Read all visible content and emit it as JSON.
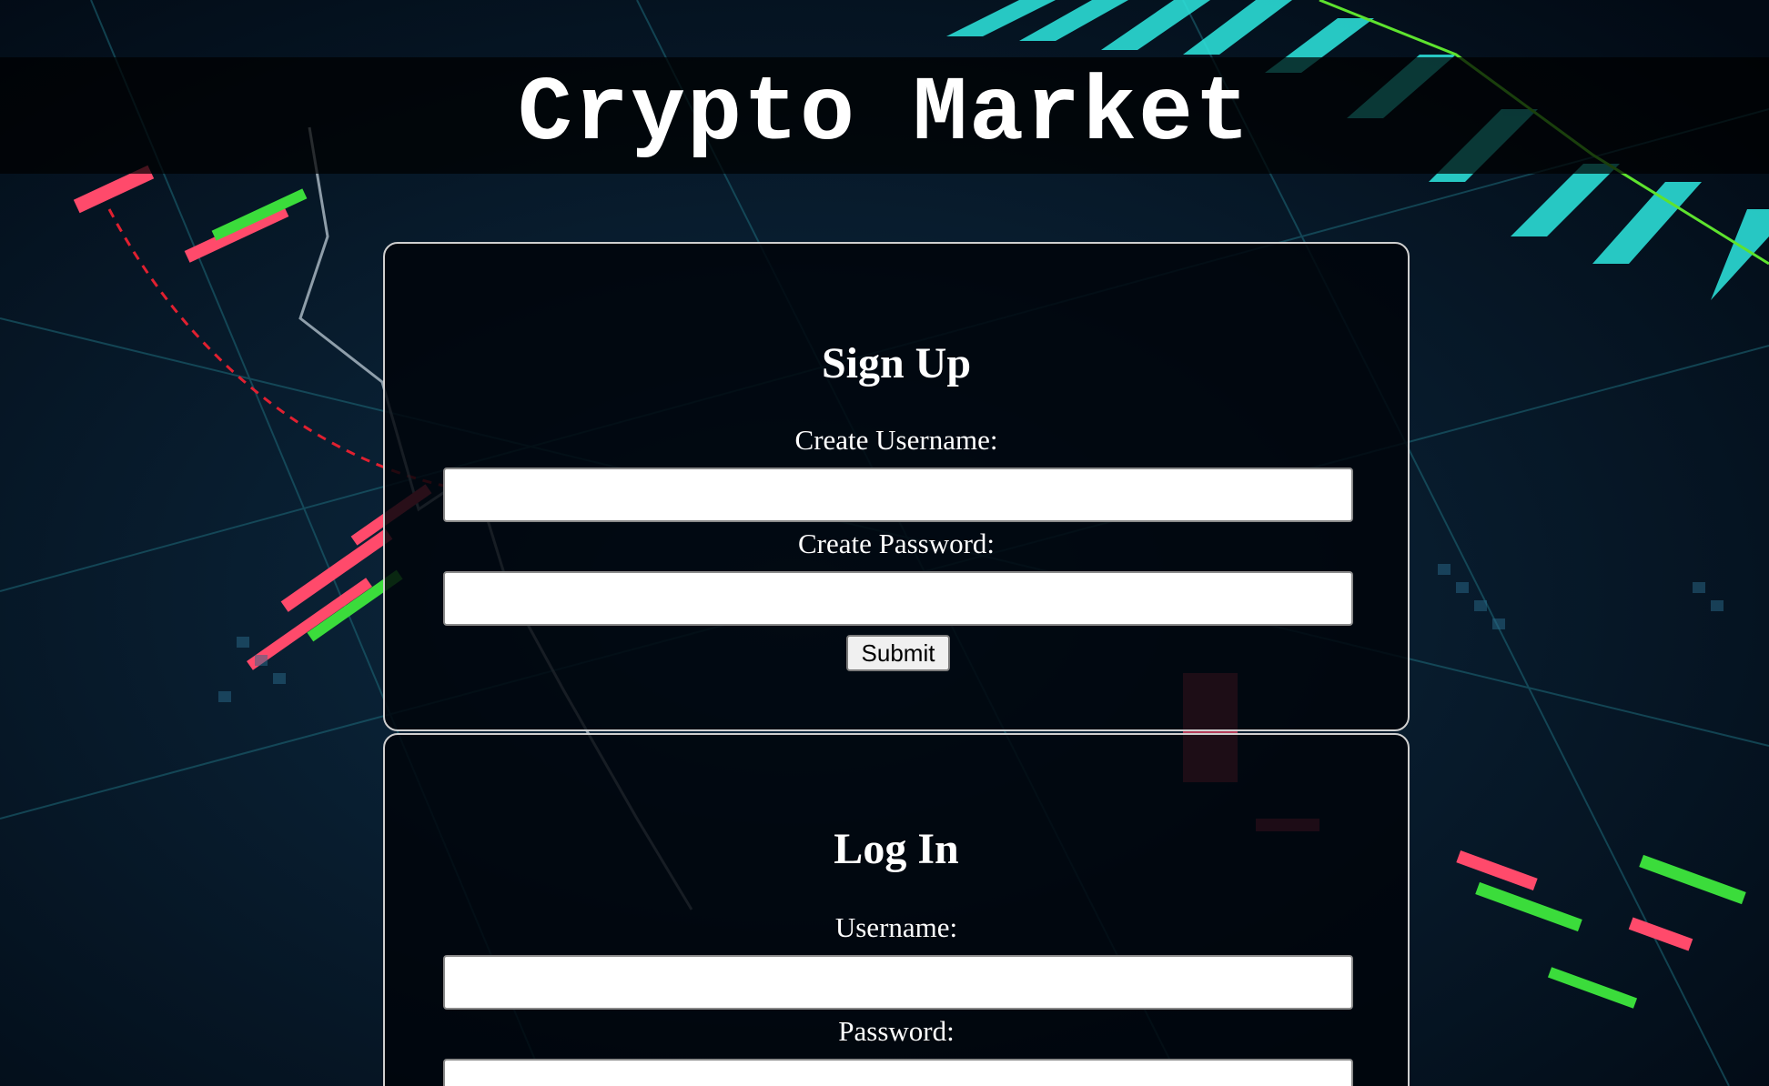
{
  "header": {
    "title": "Crypto Market"
  },
  "signup": {
    "heading": "Sign Up",
    "username_label": "Create Username:",
    "username_value": "",
    "password_label": "Create Password:",
    "password_value": "",
    "submit_label": "Submit"
  },
  "login": {
    "heading": "Log In",
    "username_label": "Username:",
    "username_value": "",
    "password_label": "Password:",
    "password_value": ""
  },
  "colors": {
    "background": "#06182a",
    "header_overlay": "#000000",
    "panel_border": "#cfcfcf",
    "candle_red": "#ff4a6b",
    "candle_green": "#3bdc3b",
    "bar_cyan": "#2ee8e0",
    "dashed_red": "#e02030"
  }
}
